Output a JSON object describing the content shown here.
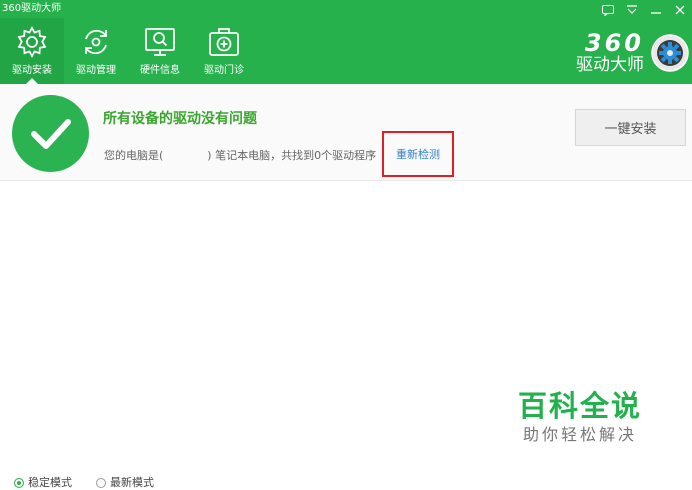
{
  "app": {
    "title": "360驱动大师"
  },
  "window_controls": [
    {
      "name": "feedback-icon"
    },
    {
      "name": "menu-icon"
    },
    {
      "name": "minimize-icon"
    },
    {
      "name": "close-icon"
    }
  ],
  "nav": {
    "active_index": 0,
    "items": [
      {
        "label": "驱动安装",
        "icon": "gear-icon"
      },
      {
        "label": "驱动管理",
        "icon": "refresh-icon"
      },
      {
        "label": "硬件信息",
        "icon": "monitor-search-icon"
      },
      {
        "label": "驱动门诊",
        "icon": "medical-kit-icon"
      }
    ]
  },
  "brand": {
    "number": "360",
    "name": "驱动大师"
  },
  "status": {
    "title": "所有设备的驱动没有问题",
    "desc_prefix": "您的电脑是(",
    "desc_suffix": ") 笔记本电脑，共找到0个驱动程序",
    "recheck_label": "重新检测",
    "install_button_label": "一键安装"
  },
  "watermark": {
    "title": "百科全说",
    "subtitle": "助你轻松解决"
  },
  "bottom_options": [
    {
      "label": "稳定模式",
      "checked": true
    },
    {
      "label": "最新模式",
      "checked": false
    }
  ],
  "colors": {
    "header_green": "#27b14c",
    "success_green": "#2bb251",
    "title_green": "#3aa62e",
    "link_blue": "#2f7fd6",
    "highlight_red": "#e02020"
  }
}
